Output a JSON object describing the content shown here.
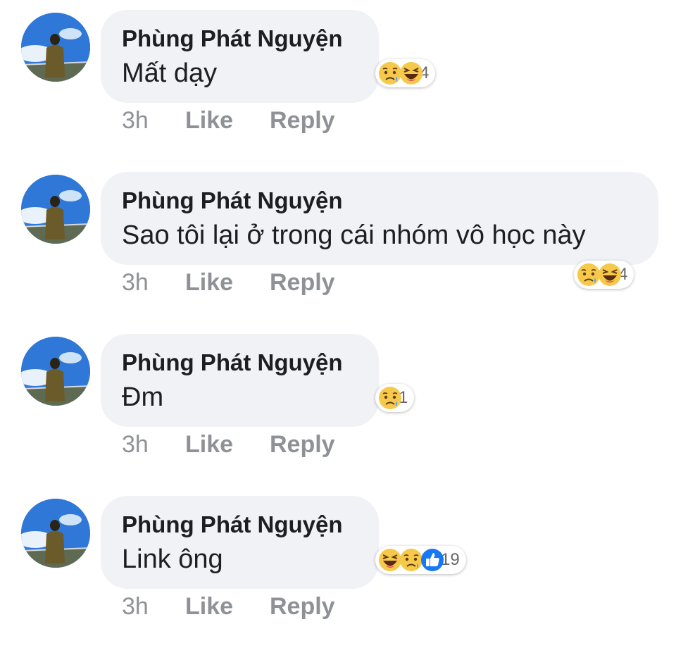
{
  "comments": [
    {
      "author": "Phùng Phát Nguyện",
      "text": "Mất dạy",
      "time": "3h",
      "like": "Like",
      "reply": "Reply",
      "reactions": [
        "sad",
        "haha"
      ],
      "reaction_count": "4"
    },
    {
      "author": "Phùng Phát Nguyện",
      "text": "Sao tôi lại ở trong cái nhóm vô học này",
      "time": "3h",
      "like": "Like",
      "reply": "Reply",
      "reactions": [
        "sad",
        "haha"
      ],
      "reaction_count": "4"
    },
    {
      "author": "Phùng Phát Nguyện",
      "text": "Đm",
      "time": "3h",
      "like": "Like",
      "reply": "Reply",
      "reactions": [
        "sad"
      ],
      "reaction_count": "1"
    },
    {
      "author": "Phùng Phát Nguyện",
      "text": "Link ông",
      "time": "3h",
      "like": "Like",
      "reply": "Reply",
      "reactions": [
        "haha",
        "sad",
        "like"
      ],
      "reaction_count": "19"
    }
  ],
  "colors": {
    "bubble": "#f0f2f5",
    "action_text": "#8e9196",
    "like_blue": "#1877f2",
    "emoji_yellow": "#f7c94b"
  }
}
